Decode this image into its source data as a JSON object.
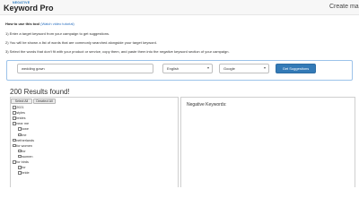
{
  "header": {
    "logo_small": "NEGATIVE",
    "logo_main": "Keyword Pro",
    "create_label": "Create ma"
  },
  "instructions": {
    "heading": "How to use this tool",
    "video_link": "(Watch video tutorial)",
    "steps": [
      "1) Enter a target keyword from your campaign to get suggestions.",
      "2) You will be shown a list of words that are commonly searched alongside your target keyword.",
      "3) Select the words that don't fit with your product or service, copy them, and paste them into the negative keyword section of your campaign."
    ]
  },
  "search": {
    "keyword_value": "wedding gown",
    "language_value": "English",
    "engine_value": "Google",
    "submit_label": "Get Suggestions"
  },
  "results": {
    "title": "200 Results found!",
    "select_all_label": "Select All",
    "deselect_all_label": "Deselect All",
    "negative_label": "Negative Keywords:",
    "keywords": [
      {
        "text": "2021",
        "level": 0
      },
      {
        "text": "styles",
        "level": 0
      },
      {
        "text": "brides",
        "level": 0
      },
      {
        "text": "near me",
        "level": 0
      },
      {
        "text": "lowe",
        "level": 1
      },
      {
        "text": "me",
        "level": 1
      },
      {
        "text": "netherlands",
        "level": 0
      },
      {
        "text": "for women",
        "level": 0
      },
      {
        "text": "for",
        "level": 1
      },
      {
        "text": "women",
        "level": 1
      },
      {
        "text": "for birds",
        "level": 0
      },
      {
        "text": "for",
        "level": 1
      },
      {
        "text": "bride",
        "level": 1
      }
    ]
  }
}
